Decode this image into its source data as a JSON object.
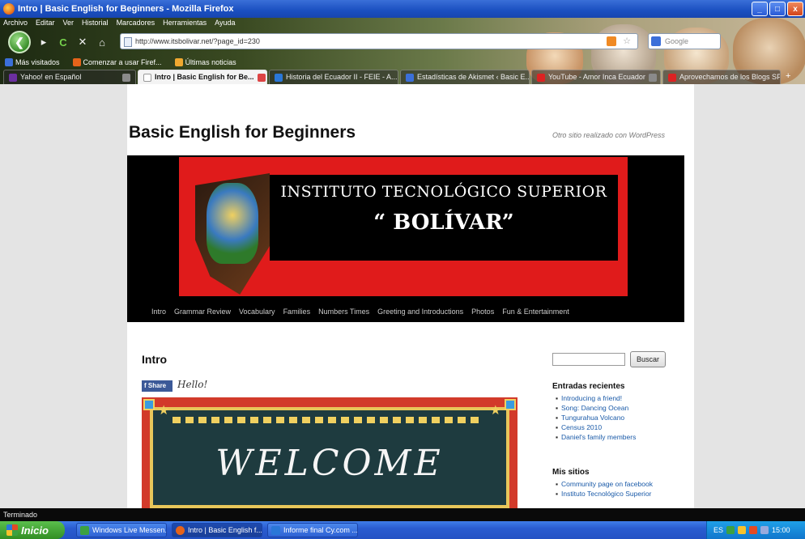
{
  "window": {
    "title": "Intro | Basic English for Beginners - Mozilla Firefox",
    "buttons": [
      "_",
      "□",
      "x"
    ]
  },
  "menu": [
    "Archivo",
    "Editar",
    "Ver",
    "Historial",
    "Marcadores",
    "Herramientas",
    "Ayuda"
  ],
  "toolbar": {
    "back_glyph": "❮",
    "forward_glyph": "▸",
    "reload_glyph": "C",
    "stop_glyph": "✕",
    "home_glyph": "⌂",
    "url": "http://www.itsbolivar.net/?page_id=230",
    "search_placeholder": "Google"
  },
  "bookmarks": [
    {
      "label": "Más visitados",
      "color": "#3b6fd9"
    },
    {
      "label": "Comenzar a usar Firef...",
      "color": "#e5631a"
    },
    {
      "label": "Últimas noticias",
      "color": "#f0a830"
    }
  ],
  "tabs": [
    {
      "label": "Yahoo! en Español",
      "color": "#6b2fa0",
      "active": false
    },
    {
      "label": "Intro | Basic English for Be...",
      "color": "#ffffff",
      "active": true
    },
    {
      "label": "Historia del Ecuador II - FEIE - A...",
      "color": "#2a77d8",
      "active": false
    },
    {
      "label": "Estadísticas de Akismet ‹ Basic E...",
      "color": "#3b6fd9",
      "active": false
    },
    {
      "label": "YouTube - Amor Inca Ecuador",
      "color": "#d22",
      "active": false
    },
    {
      "label": "Aprovechamos de los Blogs SP4...",
      "color": "#d22",
      "active": false
    }
  ],
  "tab_add": "+",
  "site": {
    "title": "Basic English for Beginners",
    "description": "Otro sitio realizado con WordPress",
    "header_line1": "INSTITUTO TECNOLÓGICO SUPERIOR",
    "header_line2": "“ BOLÍVAR”",
    "nav": [
      "Intro",
      "Grammar Review",
      "Vocabulary",
      "Families",
      "Numbers Times",
      "Greeting and Introductions",
      "Photos",
      "Fun & Entertainment"
    ]
  },
  "post": {
    "title": "Intro",
    "share_label": "Share",
    "greeting": "Hello!",
    "image_text": "WELCOME"
  },
  "sidebar": {
    "search_button": "Buscar",
    "recent_heading": "Entradas recientes",
    "recent": [
      "Introducing a friend!",
      "Song: Dancing Ocean",
      "Tungurahua Volcano",
      "Census 2010",
      "Daniel's family members"
    ],
    "sites_heading": "Mis sitios",
    "sites": [
      "Community page on facebook",
      "Instituto Tecnológico Superior"
    ]
  },
  "status": "Terminado",
  "taskbar": {
    "start": "Inicio",
    "tasks": [
      {
        "label": "Windows Live Messen...",
        "color": "#3ca142",
        "active": false
      },
      {
        "label": "Intro | Basic English f...",
        "color": "#e5631a",
        "active": true
      },
      {
        "label": "Informe final Cy.com ...",
        "color": "#2a77d8",
        "active": false
      }
    ],
    "tray_lang": "ES",
    "clock": "15:00"
  }
}
